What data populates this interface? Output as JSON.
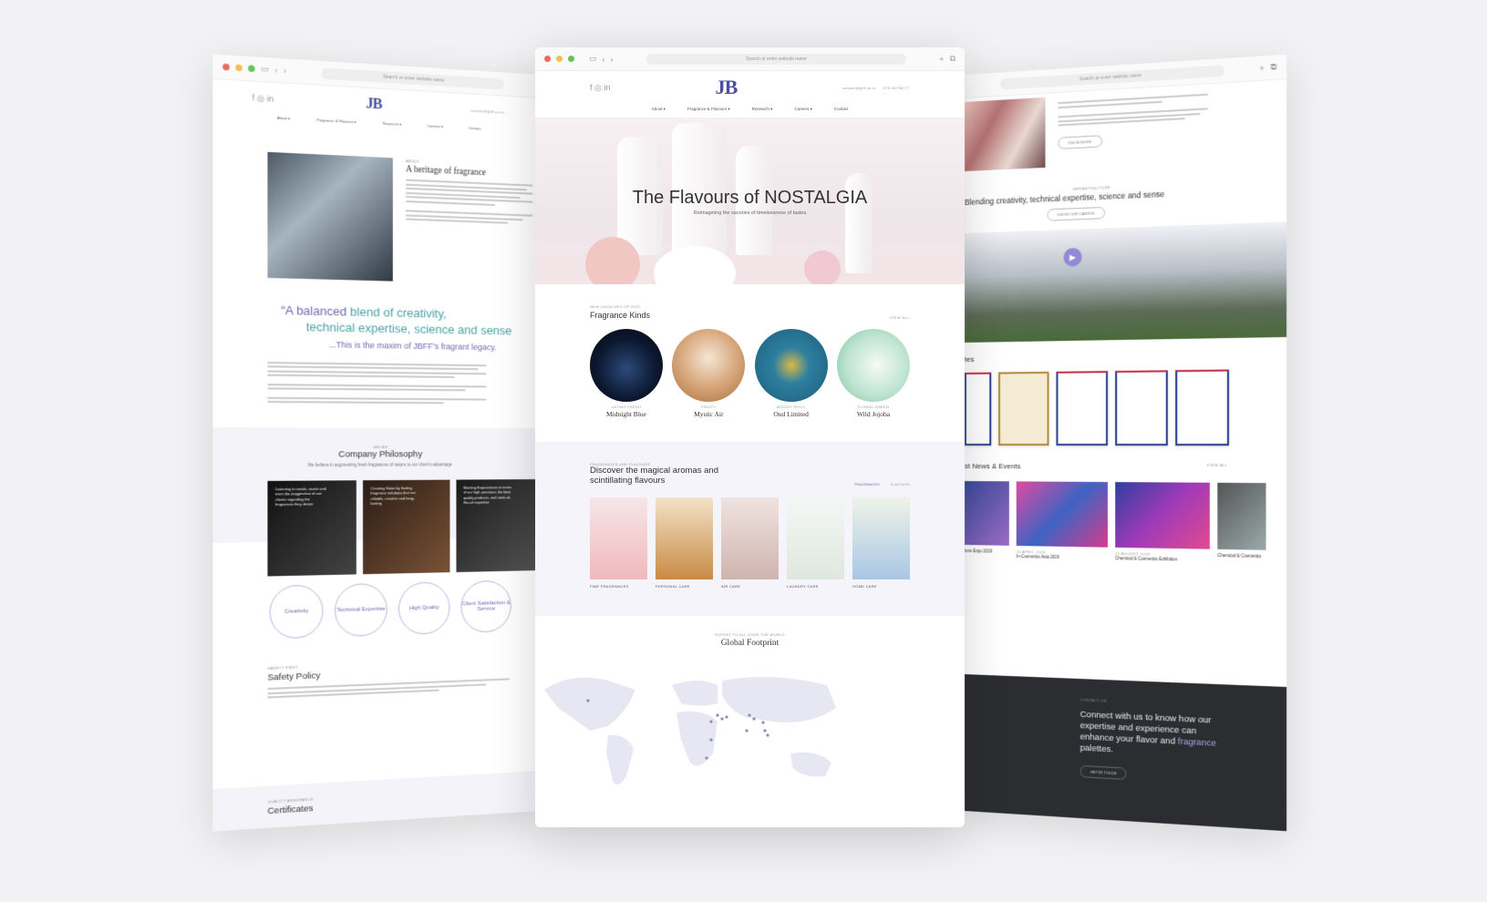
{
  "browser": {
    "url_placeholder": "Search or enter website name"
  },
  "center": {
    "header": {
      "logo": "JB",
      "email": "contact@jbff.co.in",
      "phone": "079 26756777"
    },
    "nav": [
      "About ▾",
      "Fragrance & Flavours ▾",
      "Research ▾",
      "Careers ▾",
      "Contact"
    ],
    "hero": {
      "title": "The Flavours of NOSTALGIA",
      "subtitle": "Reimagining the savories of timelessness of tastes"
    },
    "kinds_section": {
      "eyebrow": "NEW LAUNCHES OF 2023",
      "title": "Fragrance Kinds",
      "view_all": "VIEW ALL",
      "items": [
        {
          "caption": "LATINO FRESH",
          "label": "Midnight Blue",
          "color": "#0c1830"
        },
        {
          "caption": "FRUITY",
          "label": "Mystic Air",
          "color": "#c4956a"
        },
        {
          "caption": "WOODY SPICY",
          "label": "Oud Limited",
          "color": "#1e5d7a"
        },
        {
          "caption": "FLORAL GREEN",
          "label": "Wild Jojoba",
          "color": "#bfe4d0"
        }
      ]
    },
    "flavours_section": {
      "eyebrow": "FRAGRANCES AND FLAVOURS",
      "title": "Discover the magical aromas and scintillating flavours",
      "tabs": [
        "FRAGRANCES",
        "FLAVOURS"
      ],
      "categories": [
        {
          "label": "FINE FRAGRANCES",
          "color": "#f4d7d9"
        },
        {
          "label": "PERSONAL CARE",
          "color": "#d49a5c"
        },
        {
          "label": "AIR CARE",
          "color": "#e9dcd8"
        },
        {
          "label": "LAUNDRY CARE",
          "color": "#e8efe9"
        },
        {
          "label": "HOME CARE",
          "color": "#dde9da"
        }
      ]
    },
    "footprint": {
      "eyebrow": "EXPORT TO ALL OVER THE WORLD",
      "title": "Global Footprint"
    }
  },
  "left": {
    "logo": "JB",
    "email": "contact@jbff.co.in",
    "nav": [
      "About ▾",
      "Fragrance & Flavours ▾",
      "Research ▾",
      "Careers ▾",
      "Contact"
    ],
    "about": {
      "eyebrow": "ABOUT",
      "title": "A heritage of fragrance"
    },
    "quote": {
      "part1": "“A balanced",
      "part2": "blend of creativity,",
      "part3": "technical expertise, science and sense",
      "sub": "...This is the maxim of JBFF's fragrant legacy."
    },
    "philosophy": {
      "eyebrow": "BELIEF",
      "title": "Company Philosophy",
      "subtitle": "We believe in augmenting fresh fragrances of nature to our client's advantage",
      "cards": [
        "Listening to needs, wants and even the imagination of our clients regarding the fragrances they desire",
        "Creating Value by finding fragrance solutions that are reliable, creative and long-lasting",
        "Meeting Expectations in terms of our high precision, the best quality products, and state-of-the-art expertise"
      ],
      "values": [
        "Creativity",
        "Technical Expertise",
        "High Quality",
        "Client Satisfaction & Service"
      ]
    },
    "safety": {
      "eyebrow": "SAFETY FIRST",
      "title": "Safety Policy"
    },
    "certs": {
      "eyebrow": "QUALITY ASSURANCE",
      "title": "Certificates"
    }
  },
  "right": {
    "know_more": "KNOW MORE",
    "infra": {
      "eyebrow": "INFRASTRUCTURE",
      "title": "Blending creativity, technical expertise, science and sense",
      "button": "KNOW OUR CAMPUS"
    },
    "certs_title": "tes",
    "news": {
      "title": "st News & Events",
      "view_all": "VIEW ALL",
      "items": [
        {
          "title": "ions Expo 2019"
        },
        {
          "date": "14 APRIL, 2019",
          "title": "In-Cosmetics Asia 2019"
        },
        {
          "date": "25 AUGUST, 2019",
          "title": "Chemical & Cosmetics Exhibition"
        },
        {
          "title": "Chemical & Cosmetics"
        }
      ]
    },
    "footer": {
      "eyebrow": "CONTACT US",
      "title_1": "Connect with us to know how our expertise and experience can enhance your flavor and",
      "title_accent": "fragrance",
      "title_2": "palettes.",
      "button": "GET IN TOUCH"
    }
  }
}
